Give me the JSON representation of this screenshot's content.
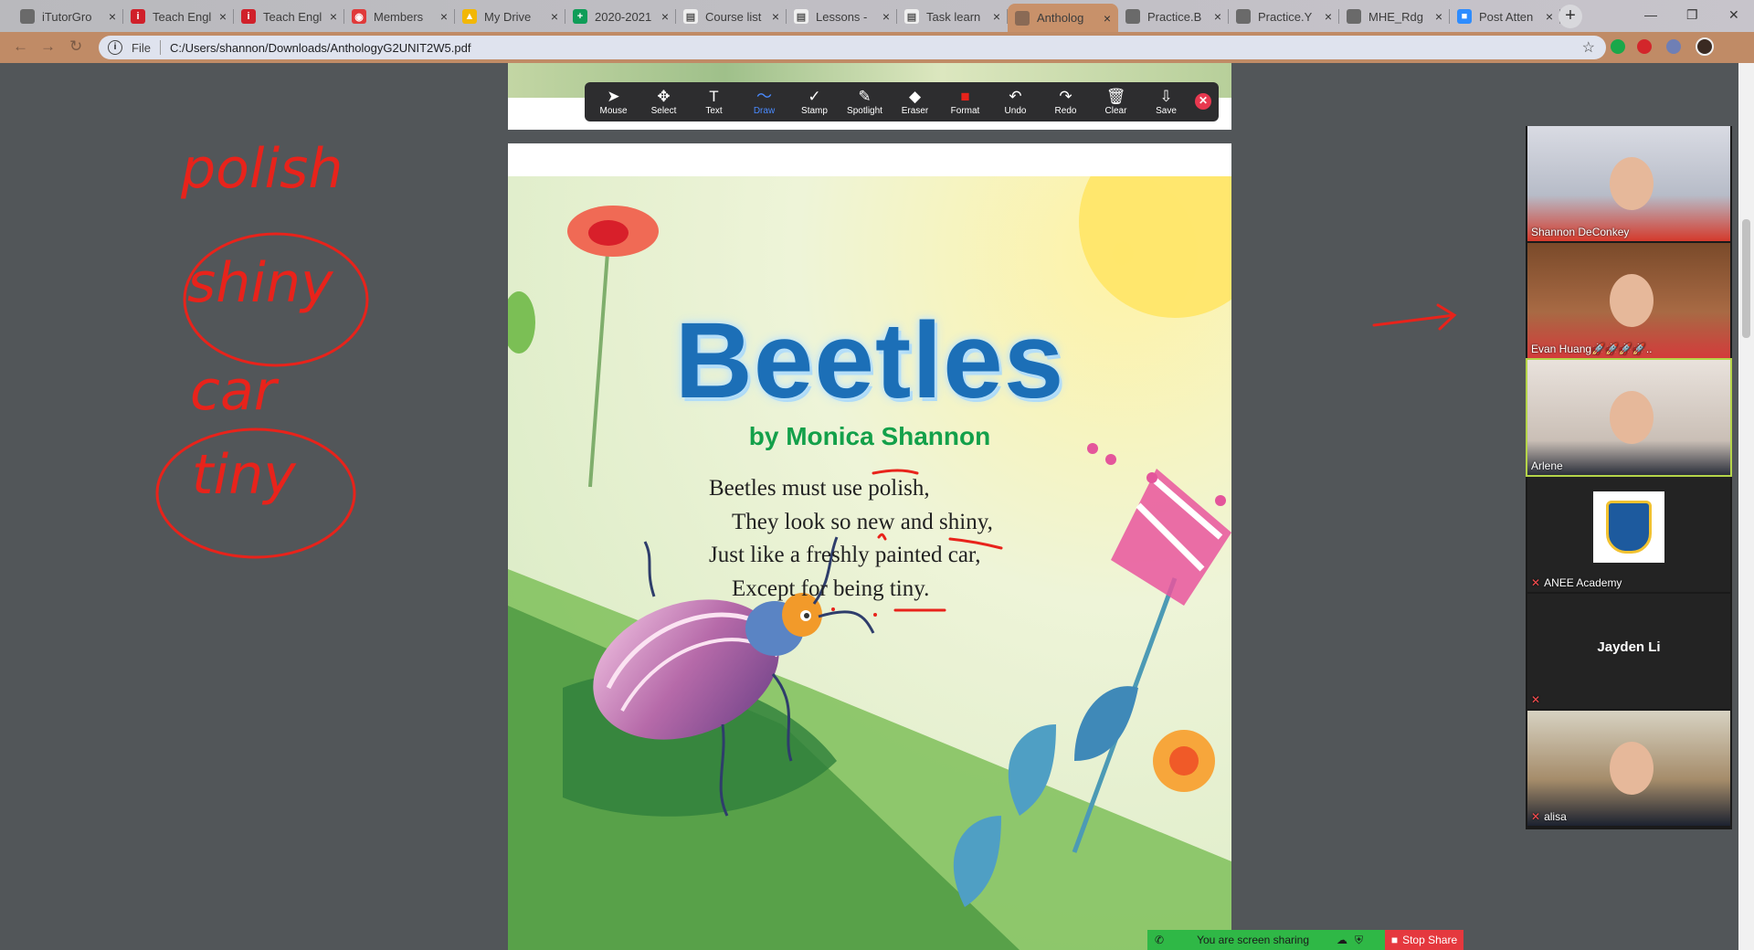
{
  "browser": {
    "tabs": [
      {
        "title": "iTutorGro",
        "favicon_color": "#6a6a6a",
        "favicon_glyph": ""
      },
      {
        "title": "Teach Engl",
        "favicon_color": "#d0202a",
        "favicon_glyph": "i"
      },
      {
        "title": "Teach Engl",
        "favicon_color": "#d0202a",
        "favicon_glyph": "i"
      },
      {
        "title": "Members",
        "favicon_color": "#e03a3a",
        "favicon_glyph": "◉"
      },
      {
        "title": "My Drive",
        "favicon_color": "#f2b705",
        "favicon_glyph": "▲"
      },
      {
        "title": "2020-2021",
        "favicon_color": "#0f9d58",
        "favicon_glyph": "+"
      },
      {
        "title": "Course list",
        "favicon_color": "#efefef",
        "favicon_glyph": "▤"
      },
      {
        "title": "Lessons - ",
        "favicon_color": "#efefef",
        "favicon_glyph": "▤"
      },
      {
        "title": "Task learn",
        "favicon_color": "#efefef",
        "favicon_glyph": "▤"
      },
      {
        "title": "Antholog",
        "favicon_color": "#8a6a55",
        "favicon_glyph": ""
      },
      {
        "title": "Practice.B",
        "favicon_color": "#6a6a6a",
        "favicon_glyph": ""
      },
      {
        "title": "Practice.Y",
        "favicon_color": "#6a6a6a",
        "favicon_glyph": ""
      },
      {
        "title": "MHE_Rdg",
        "favicon_color": "#6a6a6a",
        "favicon_glyph": ""
      },
      {
        "title": "Post Atten",
        "favicon_color": "#2d8cff",
        "favicon_glyph": "■"
      }
    ],
    "new_tab": "+",
    "window_controls": {
      "minimize": "—",
      "restore": "❐",
      "close": "✕"
    },
    "address": {
      "scheme_label": "File",
      "url": "C:/Users/shannon/Downloads/AnthologyG2UNIT2W5.pdf"
    },
    "accent_color": "#c08b66"
  },
  "annotate_toolbar": {
    "tools": [
      {
        "label": "Mouse",
        "icon": "cursor-icon",
        "glyph": "➤"
      },
      {
        "label": "Select",
        "icon": "move-icon",
        "glyph": "✥"
      },
      {
        "label": "Text",
        "icon": "text-icon",
        "glyph": "T"
      },
      {
        "label": "Draw",
        "icon": "draw-icon",
        "glyph": "〜"
      },
      {
        "label": "Stamp",
        "icon": "stamp-icon",
        "glyph": "✓"
      },
      {
        "label": "Spotlight",
        "icon": "spotlight-icon",
        "glyph": "✎"
      },
      {
        "label": "Eraser",
        "icon": "eraser-icon",
        "glyph": "◆"
      },
      {
        "label": "Format",
        "icon": "format-icon",
        "glyph": "■"
      },
      {
        "label": "Undo",
        "icon": "undo-icon",
        "glyph": "↶"
      },
      {
        "label": "Redo",
        "icon": "redo-icon",
        "glyph": "↷"
      },
      {
        "label": "Clear",
        "icon": "trash-icon",
        "glyph": "🗑"
      },
      {
        "label": "Save",
        "icon": "save-icon",
        "glyph": "⇩"
      }
    ],
    "active_tool": "Draw",
    "format_color": "#e8231b"
  },
  "pdf": {
    "title": "Beetles",
    "author": "by Monica Shannon",
    "poem_lines": [
      "Beetles must use polish,",
      "They look so new and shiny,",
      "Just like a freshly painted car,",
      "Except for being tiny."
    ]
  },
  "whiteboard_words": [
    "polish",
    "shiny",
    "car",
    "tiny"
  ],
  "participants": [
    {
      "name": "Shannon DeConkey",
      "type": "video",
      "muted": false
    },
    {
      "name": "Evan Huang🚀🚀🚀🚀..",
      "type": "video",
      "muted": false
    },
    {
      "name": "Arlene",
      "type": "video",
      "muted": false,
      "active_speaker": true
    },
    {
      "name": "ANEE Academy",
      "type": "logo",
      "muted": true
    },
    {
      "name": "Jayden Li",
      "type": "name-only",
      "muted": true
    },
    {
      "name": "alisa",
      "type": "video",
      "muted": true
    }
  ],
  "share_bar": {
    "status": "You are screen sharing",
    "stop_label": "Stop Share",
    "color": "#2fb846",
    "stop_color": "#e5383e"
  }
}
